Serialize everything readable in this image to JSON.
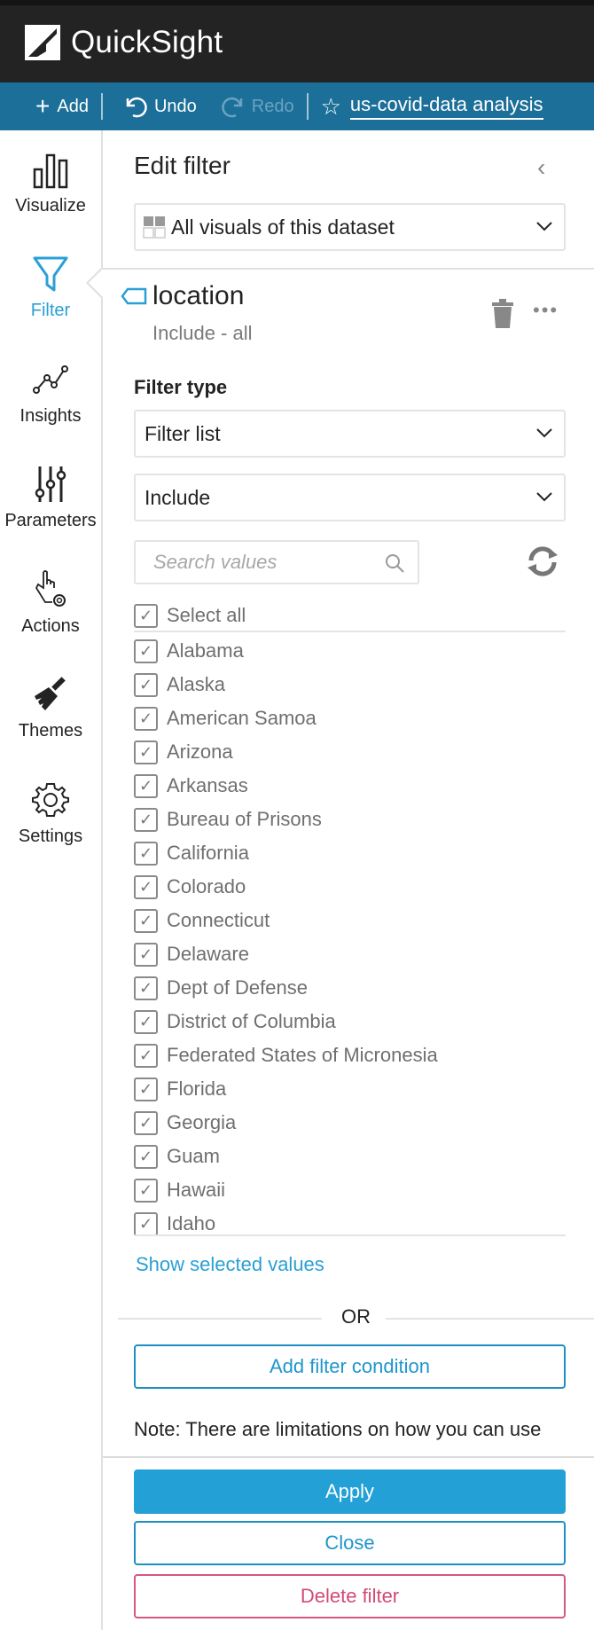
{
  "app": {
    "name": "QuickSight"
  },
  "toolbar": {
    "add_label": "Add",
    "undo_label": "Undo",
    "redo_label": "Redo",
    "analysis_title": "us-covid-data analysis"
  },
  "sidebar": {
    "items": [
      {
        "label": "Visualize",
        "icon": "bar-chart-icon",
        "active": false
      },
      {
        "label": "Filter",
        "icon": "funnel-icon",
        "active": true
      },
      {
        "label": "Insights",
        "icon": "line-chart-icon",
        "active": false
      },
      {
        "label": "Parameters",
        "icon": "sliders-icon",
        "active": false
      },
      {
        "label": "Actions",
        "icon": "pointer-gear-icon",
        "active": false
      },
      {
        "label": "Themes",
        "icon": "paintbrush-icon",
        "active": false
      },
      {
        "label": "Settings",
        "icon": "gear-icon",
        "active": false
      }
    ]
  },
  "panel": {
    "title": "Edit filter",
    "scope": "All visuals of this dataset",
    "field": {
      "name": "location",
      "summary": "Include - all"
    },
    "filter_type_label": "Filter type",
    "filter_type_value": "Filter list",
    "condition_value": "Include",
    "search_placeholder": "Search values",
    "select_all_label": "Select all",
    "values": [
      "Alabama",
      "Alaska",
      "American Samoa",
      "Arizona",
      "Arkansas",
      "Bureau of Prisons",
      "California",
      "Colorado",
      "Connecticut",
      "Delaware",
      "Dept of Defense",
      "District of Columbia",
      "Federated States of Micronesia",
      "Florida",
      "Georgia",
      "Guam",
      "Hawaii",
      "Idaho"
    ],
    "show_selected_label": "Show selected values",
    "or_label": "OR",
    "add_condition_label": "Add filter condition",
    "note": "Note: There are limitations on how you can use filters",
    "apply_label": "Apply",
    "close_label": "Close",
    "delete_label": "Delete filter"
  },
  "colors": {
    "accent": "#2aa0d4",
    "toolbar": "#1c6f98",
    "topbar": "#232323",
    "danger": "#d24a74"
  }
}
